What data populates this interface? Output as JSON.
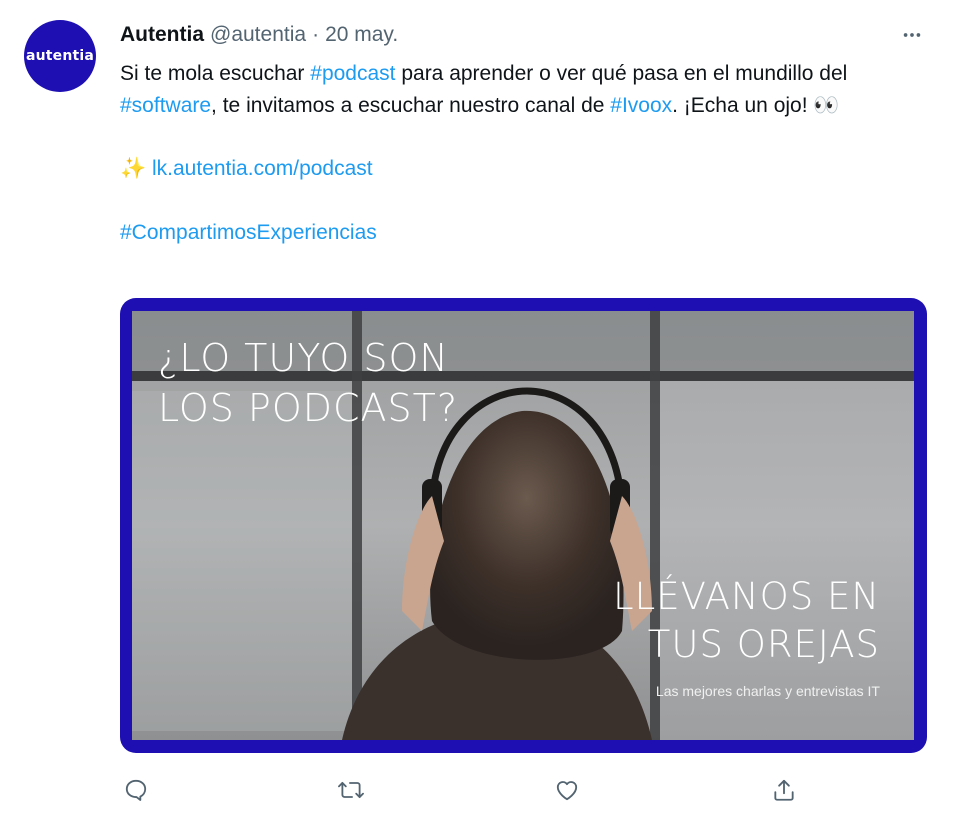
{
  "tweet": {
    "author": {
      "name": "Autentia",
      "handle": "@autentia",
      "separator": "·",
      "date": "20 may.",
      "avatar_text": "autentia"
    },
    "more_icon": "more-horizontal-icon",
    "text": {
      "line1_a": "Si te mola escuchar ",
      "hashtag_podcast": "#podcast",
      "line1_b": " para aprender o ver qué pasa en el mundillo del ",
      "hashtag_software": "#software",
      "line1_c": ", te invitamos a escuchar nuestro canal de ",
      "hashtag_ivoox": "#Ivoox",
      "line1_d": ". ¡Echa un ojo! 👀",
      "sparkles": "✨",
      "link": "lk.autentia.com/podcast",
      "hashtag_experiencias": "#CompartimosExperiencias"
    },
    "media": {
      "headline_1_line1": "¿LO TUYO SON",
      "headline_1_line2": "LOS PODCAST?",
      "headline_2_line1": "LLÉVANOS EN",
      "headline_2_line2": "TUS OREJAS",
      "subtitle": "Las mejores charlas y entrevistas IT",
      "frame_color": "#1d0fb2"
    },
    "actions": [
      {
        "icon": "reply-icon"
      },
      {
        "icon": "retweet-icon"
      },
      {
        "icon": "like-icon"
      },
      {
        "icon": "share-icon"
      }
    ],
    "colors": {
      "link": "#1d9bf0",
      "secondary": "#536471",
      "brand": "#1d0fb2"
    }
  }
}
